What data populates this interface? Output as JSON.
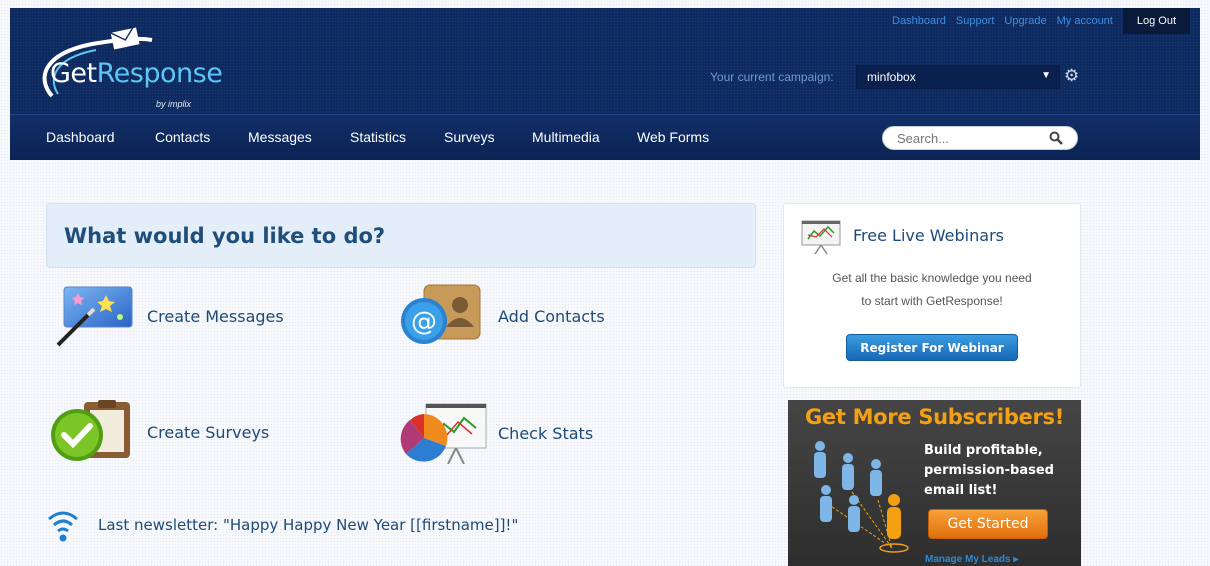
{
  "brand": {
    "name_part1": "Get",
    "name_part2": "Response",
    "byline": "by implix"
  },
  "top_links": [
    "Dashboard",
    "Support",
    "Upgrade",
    "My account"
  ],
  "logout_label": "Log Out",
  "campaign": {
    "label": "Your current campaign:",
    "value": "minfobox"
  },
  "nav": [
    "Dashboard",
    "Contacts",
    "Messages",
    "Statistics",
    "Surveys",
    "Multimedia",
    "Web Forms"
  ],
  "search": {
    "placeholder": "Search..."
  },
  "main": {
    "heading": "What would you like to do?",
    "actions": {
      "create_messages": "Create Messages",
      "add_contacts": "Add Contacts",
      "create_surveys": "Create Surveys",
      "check_stats": "Check Stats"
    },
    "last_newsletter": "Last newsletter: \"Happy Happy New Year [[firstname]]!\""
  },
  "webinar": {
    "title": "Free Live Webinars",
    "line1": "Get all the basic knowledge you need",
    "line2": "to start with GetResponse!",
    "button": "Register For Webinar"
  },
  "promo": {
    "title": "Get More Subscribers!",
    "text": "Build profitable, permission-based email list!",
    "button": "Get Started",
    "link": "Manage My Leads ▸"
  },
  "colors": {
    "header": "#0e2a5e",
    "accent_blue": "#1d4a78",
    "promo_orange": "#f4a012"
  }
}
